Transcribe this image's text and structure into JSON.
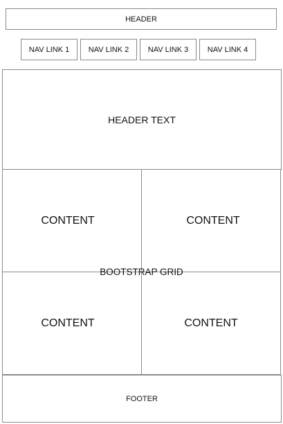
{
  "header": {
    "label": "HEADER"
  },
  "nav": {
    "links": [
      {
        "label": "NAV LINK 1"
      },
      {
        "label": "NAV LINK 2"
      },
      {
        "label": "NAV LINK 3"
      },
      {
        "label": "NAV LINK 4"
      }
    ]
  },
  "hero": {
    "label": "HEADER TEXT"
  },
  "grid": {
    "label": "BOOTSTRAP GRID",
    "cells": [
      {
        "label": "CONTENT"
      },
      {
        "label": "CONTENT"
      },
      {
        "label": "CONTENT"
      },
      {
        "label": "CONTENT"
      }
    ]
  },
  "footer": {
    "label": "FOOTER"
  }
}
